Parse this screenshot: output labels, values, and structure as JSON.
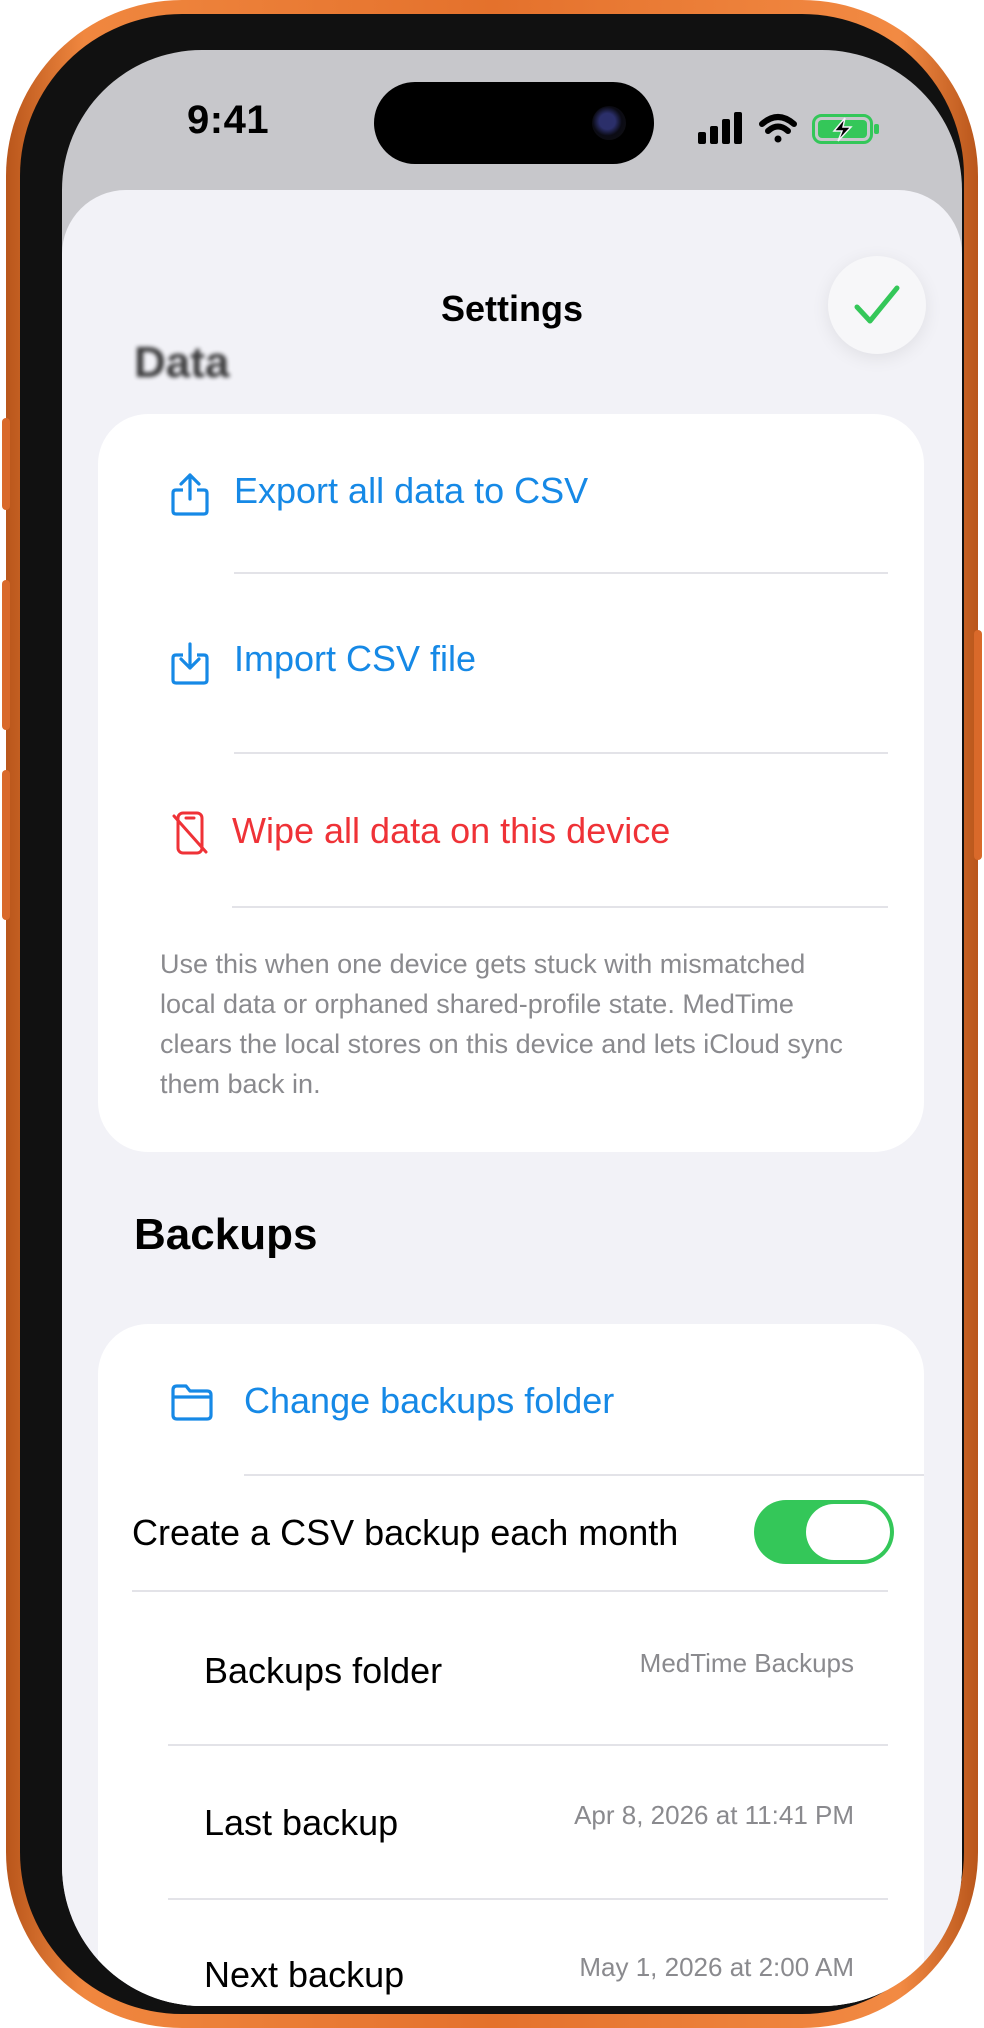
{
  "status_bar": {
    "time": "9:41"
  },
  "header": {
    "title": "Settings",
    "done_icon": "checkmark-icon"
  },
  "data_section": {
    "header": "Data",
    "items": [
      {
        "label": "Export all data to CSV",
        "icon": "share-upload-icon",
        "color": "#1689e6"
      },
      {
        "label": "Import CSV file",
        "icon": "download-tray-icon",
        "color": "#1689e6"
      },
      {
        "label": "Wipe all data on this device",
        "icon": "phone-slash-icon",
        "color": "#ef3237"
      }
    ],
    "footer": "Use this when one device gets stuck with mismatched local data or orphaned shared-profile state. MedTime clears the local stores on this device and lets iCloud sync them back in."
  },
  "backups_section": {
    "header": "Backups",
    "change_folder": {
      "label": "Change backups folder",
      "icon": "folder-icon"
    },
    "monthly_toggle": {
      "label": "Create a CSV backup each month",
      "on": true,
      "color": "#34c759"
    },
    "rows": [
      {
        "label": "Backups folder",
        "value": "MedTime Backups"
      },
      {
        "label": "Last backup",
        "value": "Apr 8, 2026 at 11:41 PM"
      },
      {
        "label": "Next backup",
        "value": "May 1, 2026 at 2:00 AM"
      }
    ]
  }
}
